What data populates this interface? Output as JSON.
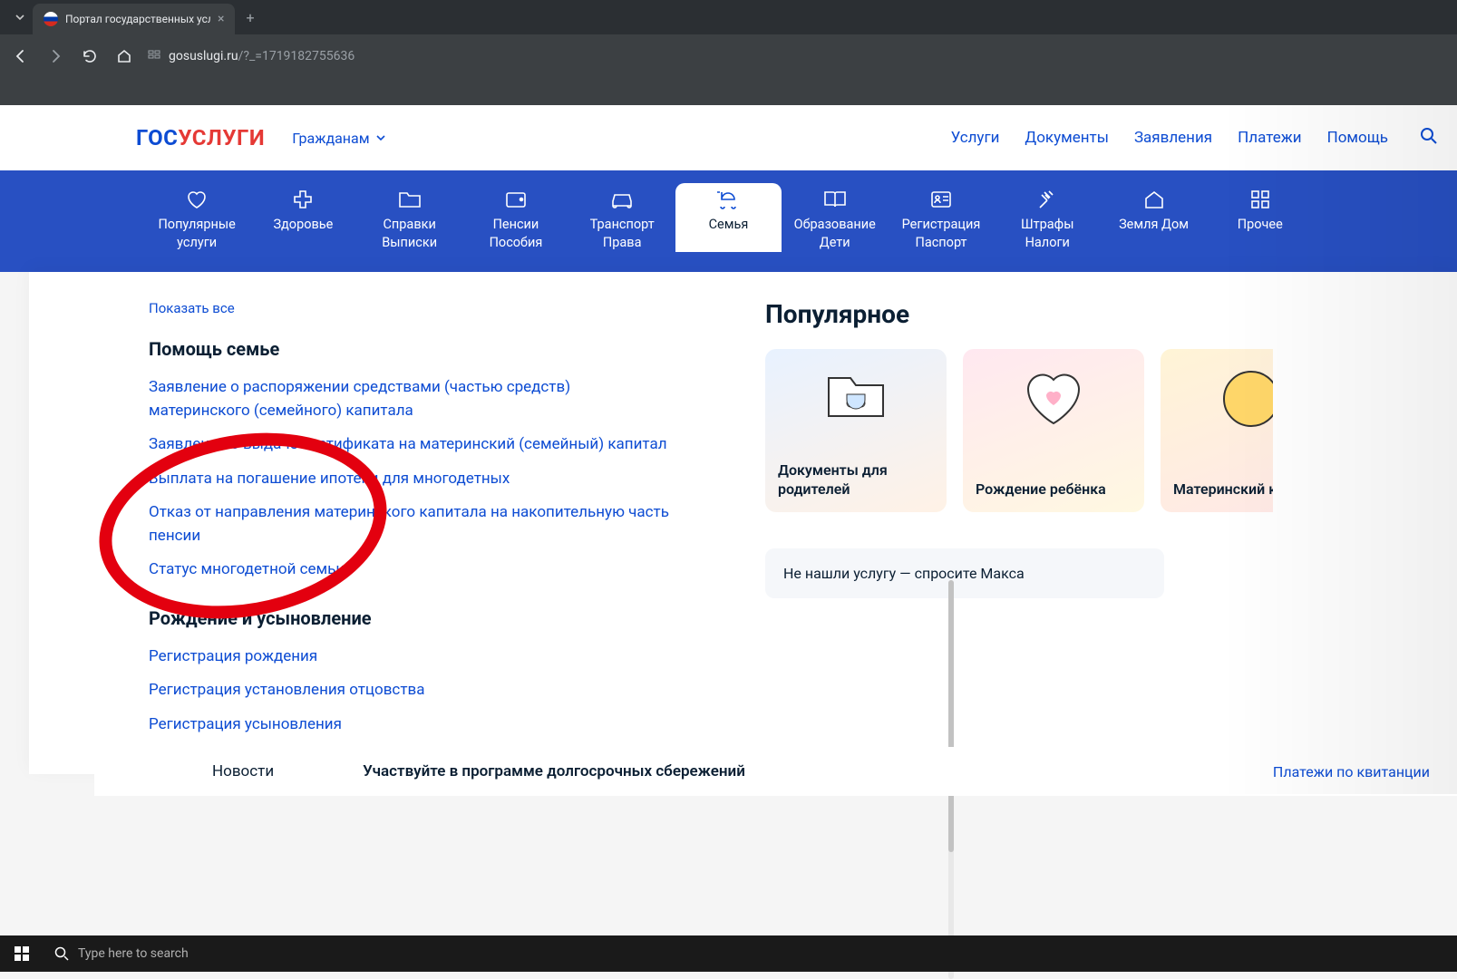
{
  "browser": {
    "tab_title": "Портал государственных услу",
    "url_host": "gosuslugi.ru",
    "url_path": "/?_=1719182755636"
  },
  "header": {
    "logo1": "ГОС",
    "logo2": "УСЛУГИ",
    "audience": "Гражданам",
    "nav": [
      "Услуги",
      "Документы",
      "Заявления",
      "Платежи",
      "Помощь"
    ]
  },
  "categories": [
    {
      "label": "Популярные услуги"
    },
    {
      "label": "Здоровье"
    },
    {
      "label": "Справки Выписки"
    },
    {
      "label": "Пенсии Пособия"
    },
    {
      "label": "Транспорт Права"
    },
    {
      "label": "Семья"
    },
    {
      "label": "Образование Дети"
    },
    {
      "label": "Регистрация Паспорт"
    },
    {
      "label": "Штрафы Налоги"
    },
    {
      "label": "Земля Дом"
    },
    {
      "label": "Прочее"
    }
  ],
  "dropdown": {
    "show_all": "Показать все",
    "section1_title": "Помощь семье",
    "section1_links": [
      "Заявление о распоряжении средствами (частью средств) материнского (семейного) капитала",
      "Заявление о выдаче сертификата на материнский (семейный) капитал",
      "Выплата на погашение ипотеки для многодетных",
      "Отказ от направления материнского капитала на накопительную часть пенсии",
      "Статус многодетной семьи"
    ],
    "section2_title": "Рождение и усыновление",
    "section2_links": [
      "Регистрация рождения",
      "Регистрация установления отцовства",
      "Регистрация усыновления"
    ],
    "popular_title": "Популярное",
    "cards": [
      {
        "title": "Документы для родителей"
      },
      {
        "title": "Рождение ребёнка"
      },
      {
        "title": "Материнский капитал"
      }
    ],
    "ask": "Не нашли услугу — спросите Макса"
  },
  "news": {
    "label": "Новости",
    "headline": "Участвуйте в программе долгосрочных сбережений",
    "side": "Платежи по квитанции"
  },
  "taskbar": {
    "search_placeholder": "Type here to search"
  }
}
